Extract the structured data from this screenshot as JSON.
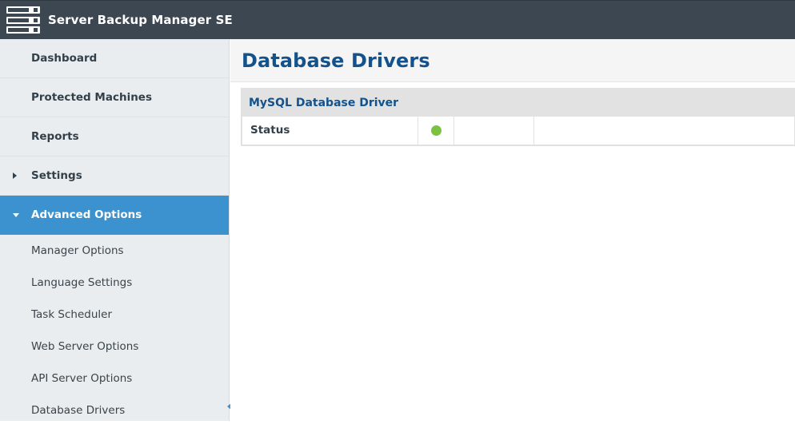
{
  "header": {
    "app_title": "Server Backup Manager SE",
    "logo_icon": "server-rack-icon"
  },
  "sidebar": {
    "top_items": [
      {
        "label": "Dashboard",
        "caret": "",
        "active": false
      },
      {
        "label": "Protected Machines",
        "caret": "",
        "active": false
      },
      {
        "label": "Reports",
        "caret": "",
        "active": false
      },
      {
        "label": "Settings",
        "caret": "chevron-right-icon",
        "active": false
      },
      {
        "label": "Advanced Options",
        "caret": "chevron-down-icon",
        "active": true
      }
    ],
    "sub_items": [
      {
        "label": "Manager Options"
      },
      {
        "label": "Language Settings"
      },
      {
        "label": "Task Scheduler"
      },
      {
        "label": "Web Server Options"
      },
      {
        "label": "API Server Options"
      },
      {
        "label": "Database Drivers"
      }
    ],
    "collapse_handle_icon": "chevron-left-icon"
  },
  "main": {
    "page_title": "Database Drivers",
    "panel": {
      "title": "MySQL Database Driver",
      "rows": [
        {
          "label": "Status",
          "status_indicator": "green-dot-icon",
          "mid": "",
          "rest": ""
        }
      ]
    }
  },
  "colors": {
    "topbar": "#3c4751",
    "sidebar": "#e9edef",
    "active_nav": "#3b92cf",
    "heading_blue": "#12538e",
    "status_green": "#7cc242",
    "panel_header": "#e2e2e2"
  }
}
